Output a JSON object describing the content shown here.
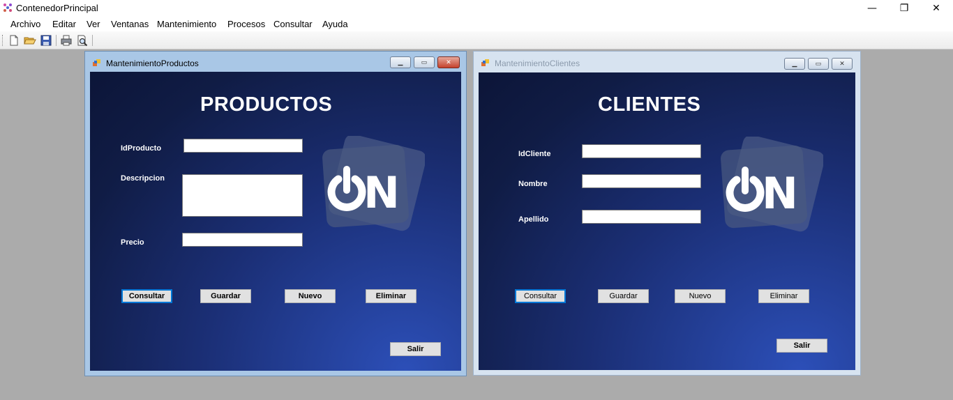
{
  "app": {
    "title": "ContenedorPrincipal",
    "controls": {
      "minimize": "—",
      "restore": "❐",
      "close": "✕"
    }
  },
  "menu": {
    "items": [
      "Archivo",
      "Editar",
      "Ver",
      "Ventanas",
      "Mantenimiento",
      "Procesos",
      "Consultar",
      "Ayuda"
    ]
  },
  "toolbar": {
    "buttons": [
      "new-icon",
      "open-folder-icon",
      "save-icon",
      "print-icon",
      "print-preview-icon"
    ]
  },
  "productos_window": {
    "title": "MantenimientoProductos",
    "heading": "PRODUCTOS",
    "labels": {
      "id": "IdProducto",
      "descripcion": "Descripcion",
      "precio": "Precio"
    },
    "values": {
      "id": "",
      "descripcion": "",
      "precio": ""
    },
    "buttons": {
      "consultar": "Consultar",
      "guardar": "Guardar",
      "nuevo": "Nuevo",
      "eliminar": "Eliminar",
      "salir": "Salir"
    },
    "logo_text": "ON"
  },
  "clientes_window": {
    "title": "MantenimientoClientes",
    "heading": "CLIENTES",
    "labels": {
      "id": "IdCliente",
      "nombre": "Nombre",
      "apellido": "Apellido"
    },
    "values": {
      "id": "",
      "nombre": "",
      "apellido": ""
    },
    "buttons": {
      "consultar": "Consultar",
      "guardar": "Guardar",
      "nuevo": "Nuevo",
      "eliminar": "Eliminar",
      "salir": "Salir"
    },
    "logo_text": "ON"
  },
  "colors": {
    "mdi_background": "#ababab",
    "form_gradient_dark": "#0c1538",
    "form_gradient_light": "#2c4fb8",
    "focus_border": "#0078d7"
  }
}
